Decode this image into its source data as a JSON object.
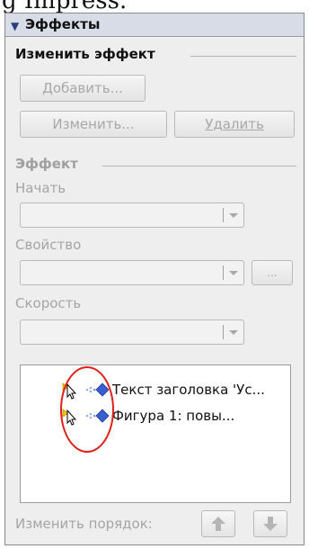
{
  "caption_partial": "g Impress.",
  "panel": {
    "title": "Эффекты",
    "change_section": "Изменить эффект",
    "add_button": "Добавить...",
    "modify_button": "Изменить...",
    "delete_button": "Удалить",
    "effect_section": "Эффект",
    "start_label": "Начать",
    "property_label": "Свойство",
    "more_button": "...",
    "speed_label": "Скорость",
    "list_items": [
      {
        "text": "Текст заголовка 'Ус..."
      },
      {
        "text": "Фигура 1:      повы..."
      }
    ],
    "reorder_label": "Изменить порядок:",
    "move_up_icon": "arrow-up-icon",
    "move_down_icon": "arrow-down-icon"
  },
  "colors": {
    "annotation": "#e0201a",
    "header": "#d8dce6",
    "disabled_text": "#a5a5a5"
  }
}
